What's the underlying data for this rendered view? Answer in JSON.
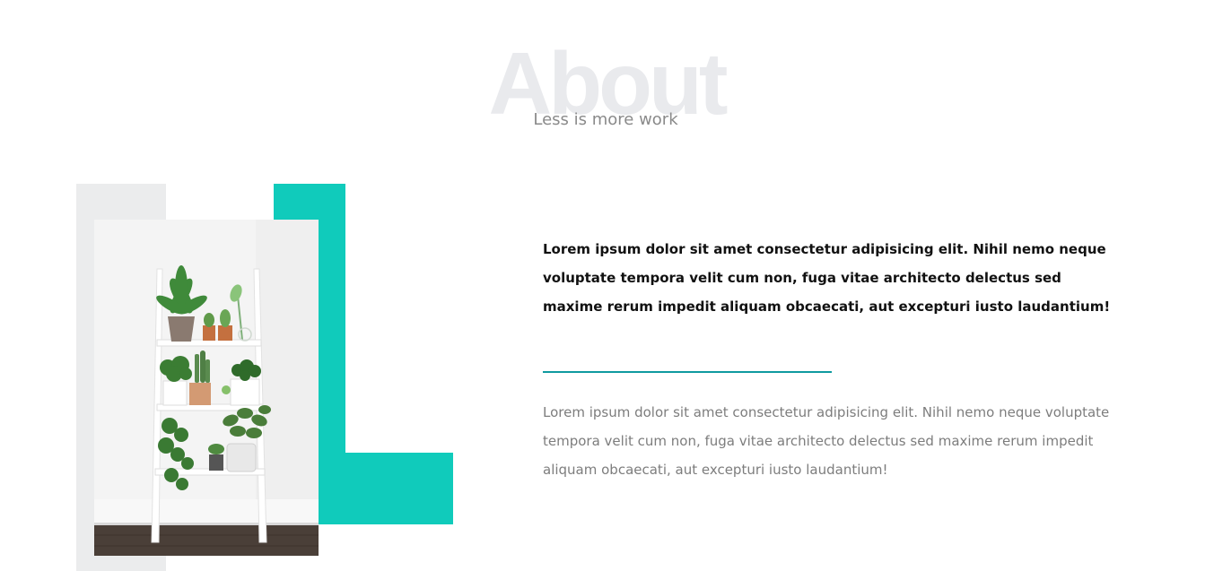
{
  "header": {
    "bg_heading": "About",
    "subtitle": "Less is more work"
  },
  "about": {
    "image_alt": "Plants on a white ladder shelf",
    "lead_text": "Lorem ipsum dolor sit amet consectetur adipisicing elit. Nihil nemo neque voluptate tempora velit cum non, fuga vitae architecto delectus sed maxime rerum impedit aliquam obcaecati, aut excepturi iusto laudantium!",
    "body_text": "Lorem ipsum dolor sit amet consectetur adipisicing elit. Nihil nemo neque voluptate tempora velit cum non, fuga vitae architecto delectus sed maxime rerum impedit aliquam obcaecati, aut excepturi iusto laudantium!"
  },
  "colors": {
    "accent": "#10cbbb",
    "divider": "#0f9aa0",
    "block_gray": "#ebeced",
    "heading_gray": "#e9eaed"
  }
}
